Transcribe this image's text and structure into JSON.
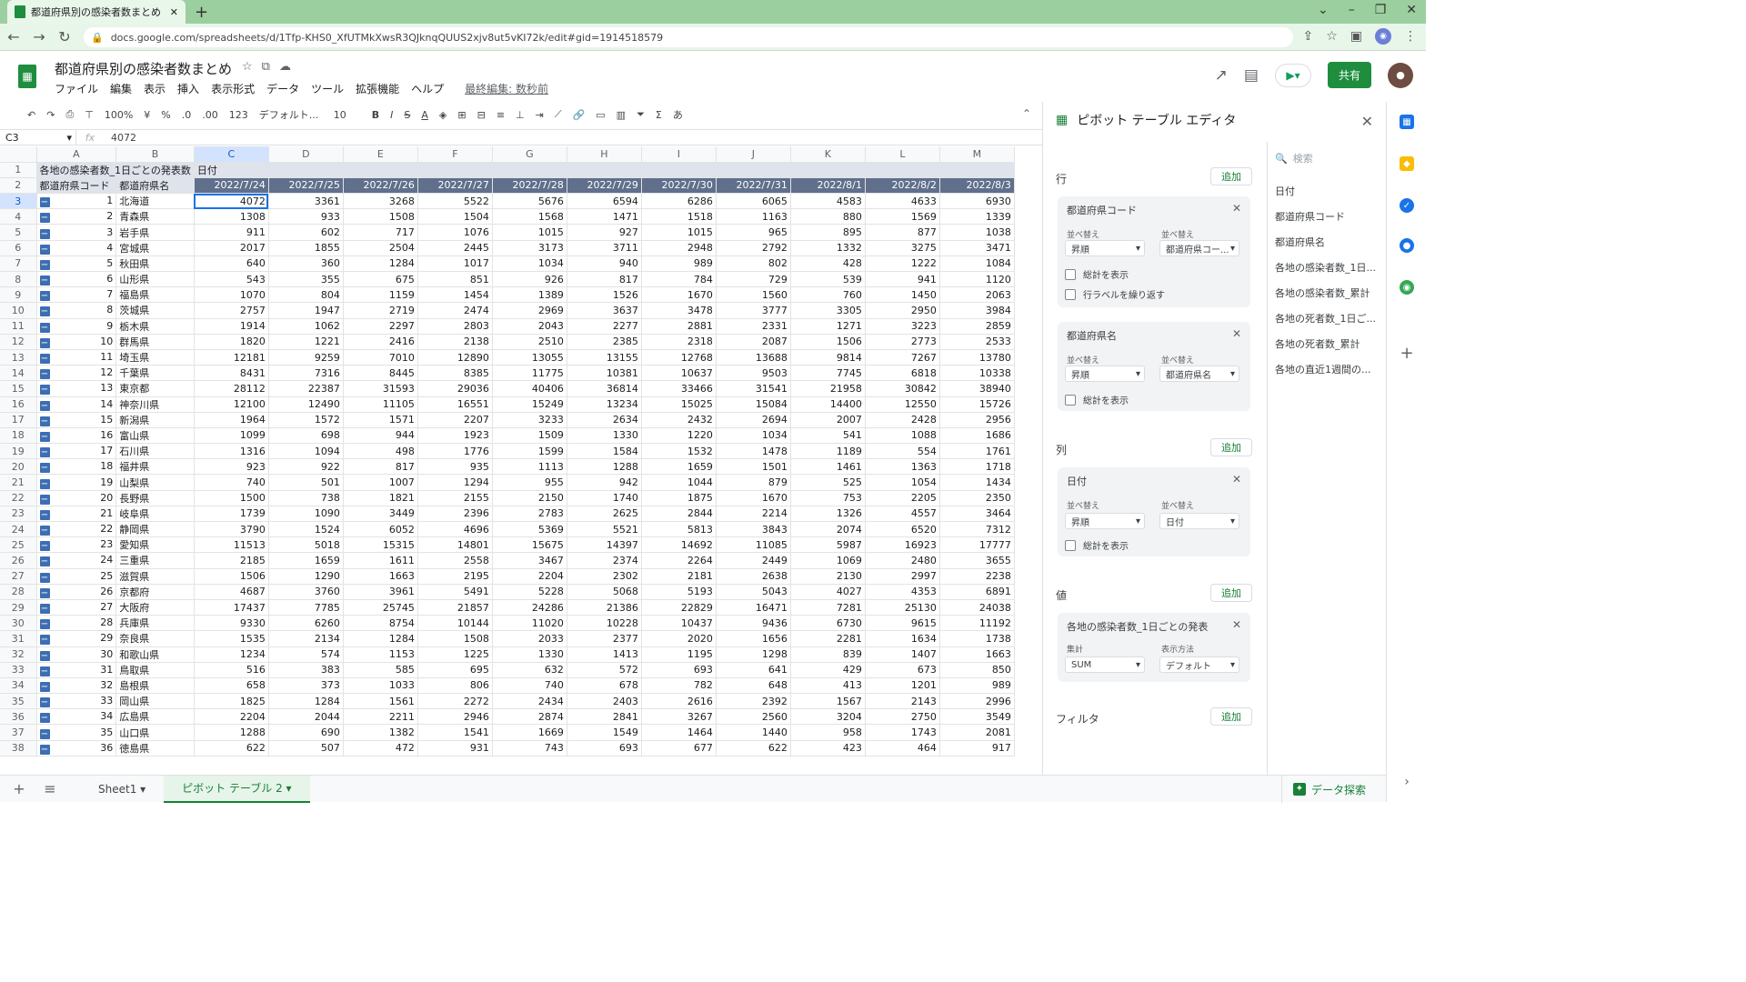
{
  "browser": {
    "tab_title": "都道府県別の感染者数まとめ - Go",
    "tab_close": "✕",
    "new_tab": "+",
    "url": "docs.google.com/spreadsheets/d/1Tfp-KHS0_XfUTMkXwsR3QJknqQUUS2xjv8ut5vKI72k/edit#gid=1914518579"
  },
  "app": {
    "doc_title": "都道府県別の感染者数まとめ",
    "menus": [
      "ファイル",
      "編集",
      "表示",
      "挿入",
      "表示形式",
      "データ",
      "ツール",
      "拡張機能",
      "ヘルプ"
    ],
    "last_edit": "最終編集: 数秒前",
    "share_label": "共有"
  },
  "toolbar": {
    "zoom": "100%",
    "currency": "¥",
    "percent": "%",
    "dec_less": ".0",
    "dec_more": ".00",
    "format_more": "123",
    "font": "デフォルト...",
    "font_size": "10",
    "bold": "B",
    "italic": "I",
    "strike": "S",
    "text_color": "A",
    "input_tool": "あ"
  },
  "formula_bar": {
    "cell_ref": "C3",
    "fx": "fx",
    "value": "4072"
  },
  "grid": {
    "col_letters": [
      "A",
      "B",
      "C",
      "D",
      "E",
      "F",
      "G",
      "H",
      "I",
      "J",
      "K",
      "L",
      "M"
    ],
    "row1_label": "各地の感染者数_1日ごとの発表数",
    "row1_col": "日付",
    "row2_a": "都道府県コード",
    "row2_b": "都道府県名",
    "dates": [
      "2022/7/24",
      "2022/7/25",
      "2022/7/26",
      "2022/7/27",
      "2022/7/28",
      "2022/7/29",
      "2022/7/30",
      "2022/7/31",
      "2022/8/1",
      "2022/8/2",
      "2022/8/3"
    ],
    "rows": [
      {
        "rn": "3",
        "code": "1",
        "name": "北海道",
        "v": [
          "4072",
          "3361",
          "3268",
          "5522",
          "5676",
          "6594",
          "6286",
          "6065",
          "4583",
          "4633",
          "6930"
        ]
      },
      {
        "rn": "4",
        "code": "2",
        "name": "青森県",
        "v": [
          "1308",
          "933",
          "1508",
          "1504",
          "1568",
          "1471",
          "1518",
          "1163",
          "880",
          "1569",
          "1339"
        ]
      },
      {
        "rn": "5",
        "code": "3",
        "name": "岩手県",
        "v": [
          "911",
          "602",
          "717",
          "1076",
          "1015",
          "927",
          "1015",
          "965",
          "895",
          "877",
          "1038"
        ]
      },
      {
        "rn": "6",
        "code": "4",
        "name": "宮城県",
        "v": [
          "2017",
          "1855",
          "2504",
          "2445",
          "3173",
          "3711",
          "2948",
          "2792",
          "1332",
          "3275",
          "3471"
        ]
      },
      {
        "rn": "7",
        "code": "5",
        "name": "秋田県",
        "v": [
          "640",
          "360",
          "1284",
          "1017",
          "1034",
          "940",
          "989",
          "802",
          "428",
          "1222",
          "1084"
        ]
      },
      {
        "rn": "8",
        "code": "6",
        "name": "山形県",
        "v": [
          "543",
          "355",
          "675",
          "851",
          "926",
          "817",
          "784",
          "729",
          "539",
          "941",
          "1120"
        ]
      },
      {
        "rn": "9",
        "code": "7",
        "name": "福島県",
        "v": [
          "1070",
          "804",
          "1159",
          "1454",
          "1389",
          "1526",
          "1670",
          "1560",
          "760",
          "1450",
          "2063"
        ]
      },
      {
        "rn": "10",
        "code": "8",
        "name": "茨城県",
        "v": [
          "2757",
          "1947",
          "2719",
          "2474",
          "2969",
          "3637",
          "3478",
          "3777",
          "3305",
          "2950",
          "3984"
        ]
      },
      {
        "rn": "11",
        "code": "9",
        "name": "栃木県",
        "v": [
          "1914",
          "1062",
          "2297",
          "2803",
          "2043",
          "2277",
          "2881",
          "2331",
          "1271",
          "3223",
          "2859"
        ]
      },
      {
        "rn": "12",
        "code": "10",
        "name": "群馬県",
        "v": [
          "1820",
          "1221",
          "2416",
          "2138",
          "2510",
          "2385",
          "2318",
          "2087",
          "1506",
          "2773",
          "2533"
        ]
      },
      {
        "rn": "13",
        "code": "11",
        "name": "埼玉県",
        "v": [
          "12181",
          "9259",
          "7010",
          "12890",
          "13055",
          "13155",
          "12768",
          "13688",
          "9814",
          "7267",
          "13780"
        ]
      },
      {
        "rn": "14",
        "code": "12",
        "name": "千葉県",
        "v": [
          "8431",
          "7316",
          "8445",
          "8385",
          "11775",
          "10381",
          "10637",
          "9503",
          "7745",
          "6818",
          "10338"
        ]
      },
      {
        "rn": "15",
        "code": "13",
        "name": "東京都",
        "v": [
          "28112",
          "22387",
          "31593",
          "29036",
          "40406",
          "36814",
          "33466",
          "31541",
          "21958",
          "30842",
          "38940"
        ]
      },
      {
        "rn": "16",
        "code": "14",
        "name": "神奈川県",
        "v": [
          "12100",
          "12490",
          "11105",
          "16551",
          "15249",
          "13234",
          "15025",
          "15084",
          "14400",
          "12550",
          "15726"
        ]
      },
      {
        "rn": "17",
        "code": "15",
        "name": "新潟県",
        "v": [
          "1964",
          "1572",
          "1571",
          "2207",
          "3233",
          "2634",
          "2432",
          "2694",
          "2007",
          "2428",
          "2956"
        ]
      },
      {
        "rn": "18",
        "code": "16",
        "name": "富山県",
        "v": [
          "1099",
          "698",
          "944",
          "1923",
          "1509",
          "1330",
          "1220",
          "1034",
          "541",
          "1088",
          "1686"
        ]
      },
      {
        "rn": "19",
        "code": "17",
        "name": "石川県",
        "v": [
          "1316",
          "1094",
          "498",
          "1776",
          "1599",
          "1584",
          "1532",
          "1478",
          "1189",
          "554",
          "1761"
        ]
      },
      {
        "rn": "20",
        "code": "18",
        "name": "福井県",
        "v": [
          "923",
          "922",
          "817",
          "935",
          "1113",
          "1288",
          "1659",
          "1501",
          "1461",
          "1363",
          "1718"
        ]
      },
      {
        "rn": "21",
        "code": "19",
        "name": "山梨県",
        "v": [
          "740",
          "501",
          "1007",
          "1294",
          "955",
          "942",
          "1044",
          "879",
          "525",
          "1054",
          "1434"
        ]
      },
      {
        "rn": "22",
        "code": "20",
        "name": "長野県",
        "v": [
          "1500",
          "738",
          "1821",
          "2155",
          "2150",
          "1740",
          "1875",
          "1670",
          "753",
          "2205",
          "2350"
        ]
      },
      {
        "rn": "23",
        "code": "21",
        "name": "岐阜県",
        "v": [
          "1739",
          "1090",
          "3449",
          "2396",
          "2783",
          "2625",
          "2844",
          "2214",
          "1326",
          "4557",
          "3464"
        ]
      },
      {
        "rn": "24",
        "code": "22",
        "name": "静岡県",
        "v": [
          "3790",
          "1524",
          "6052",
          "4696",
          "5369",
          "5521",
          "5813",
          "3843",
          "2074",
          "6520",
          "7312"
        ]
      },
      {
        "rn": "25",
        "code": "23",
        "name": "愛知県",
        "v": [
          "11513",
          "5018",
          "15315",
          "14801",
          "15675",
          "14397",
          "14692",
          "11085",
          "5987",
          "16923",
          "17777"
        ]
      },
      {
        "rn": "26",
        "code": "24",
        "name": "三重県",
        "v": [
          "2185",
          "1659",
          "1611",
          "2558",
          "3467",
          "2374",
          "2264",
          "2449",
          "1069",
          "2480",
          "3655"
        ]
      },
      {
        "rn": "27",
        "code": "25",
        "name": "滋賀県",
        "v": [
          "1506",
          "1290",
          "1663",
          "2195",
          "2204",
          "2302",
          "2181",
          "2638",
          "2130",
          "2997",
          "2238"
        ]
      },
      {
        "rn": "28",
        "code": "26",
        "name": "京都府",
        "v": [
          "4687",
          "3760",
          "3961",
          "5491",
          "5228",
          "5068",
          "5193",
          "5043",
          "4027",
          "4353",
          "6891"
        ]
      },
      {
        "rn": "29",
        "code": "27",
        "name": "大阪府",
        "v": [
          "17437",
          "7785",
          "25745",
          "21857",
          "24286",
          "21386",
          "22829",
          "16471",
          "7281",
          "25130",
          "24038"
        ]
      },
      {
        "rn": "30",
        "code": "28",
        "name": "兵庫県",
        "v": [
          "9330",
          "6260",
          "8754",
          "10144",
          "11020",
          "10228",
          "10437",
          "9436",
          "6730",
          "9615",
          "11192"
        ]
      },
      {
        "rn": "31",
        "code": "29",
        "name": "奈良県",
        "v": [
          "1535",
          "2134",
          "1284",
          "1508",
          "2033",
          "2377",
          "2020",
          "1656",
          "2281",
          "1634",
          "1738"
        ]
      },
      {
        "rn": "32",
        "code": "30",
        "name": "和歌山県",
        "v": [
          "1234",
          "574",
          "1153",
          "1225",
          "1330",
          "1413",
          "1195",
          "1298",
          "839",
          "1407",
          "1663"
        ]
      },
      {
        "rn": "33",
        "code": "31",
        "name": "鳥取県",
        "v": [
          "516",
          "383",
          "585",
          "695",
          "632",
          "572",
          "693",
          "641",
          "429",
          "673",
          "850"
        ]
      },
      {
        "rn": "34",
        "code": "32",
        "name": "島根県",
        "v": [
          "658",
          "373",
          "1033",
          "806",
          "740",
          "678",
          "782",
          "648",
          "413",
          "1201",
          "989"
        ]
      },
      {
        "rn": "35",
        "code": "33",
        "name": "岡山県",
        "v": [
          "1825",
          "1284",
          "1561",
          "2272",
          "2434",
          "2403",
          "2616",
          "2392",
          "1567",
          "2143",
          "2996"
        ]
      },
      {
        "rn": "36",
        "code": "34",
        "name": "広島県",
        "v": [
          "2204",
          "2044",
          "2211",
          "2946",
          "2874",
          "2841",
          "3267",
          "2560",
          "3204",
          "2750",
          "3549"
        ]
      },
      {
        "rn": "37",
        "code": "35",
        "name": "山口県",
        "v": [
          "1288",
          "690",
          "1382",
          "1541",
          "1669",
          "1549",
          "1464",
          "1440",
          "958",
          "1743",
          "2081"
        ]
      },
      {
        "rn": "38",
        "code": "36",
        "name": "徳島県",
        "v": [
          "622",
          "507",
          "472",
          "931",
          "743",
          "693",
          "677",
          "622",
          "423",
          "464",
          "917"
        ]
      }
    ]
  },
  "sheets": {
    "tabs": [
      "Sheet1",
      "ピボット テーブル 2"
    ],
    "active": 1,
    "explore": "データ探索"
  },
  "pivot": {
    "title": "ピボット テーブル エディタ",
    "rows_label": "行",
    "columns_label": "列",
    "values_label": "値",
    "filters_label": "フィルタ",
    "add_label": "追加",
    "order_label": "並べ替え",
    "sortby_label": "並べ替え",
    "show_totals": "総計を表示",
    "repeat_labels": "行ラベルを繰り返す",
    "row_field1": {
      "name": "都道府県コード",
      "order": "昇順",
      "sort_by": "都道府県コー..."
    },
    "row_field2": {
      "name": "都道府県名",
      "order": "昇順",
      "sort_by": "都道府県名"
    },
    "col_field": {
      "name": "日付",
      "order": "昇順",
      "sort_by": "日付"
    },
    "value_field": {
      "name": "各地の感染者数_1日ごとの発表",
      "summarize_label": "集計",
      "summarize": "SUM",
      "show_as_label": "表示方法",
      "show_as": "デフォルト"
    },
    "search_placeholder": "検索",
    "fields": [
      "日付",
      "都道府県コード",
      "都道府県名",
      "各地の感染者数_1日...",
      "各地の感染者数_累計",
      "各地の死者数_1日ご...",
      "各地の死者数_累計",
      "各地の直近1週間の..."
    ]
  },
  "colors": {
    "accent": "#188038",
    "header_band": "#5f6f8c",
    "selection": "#1a73e8"
  }
}
